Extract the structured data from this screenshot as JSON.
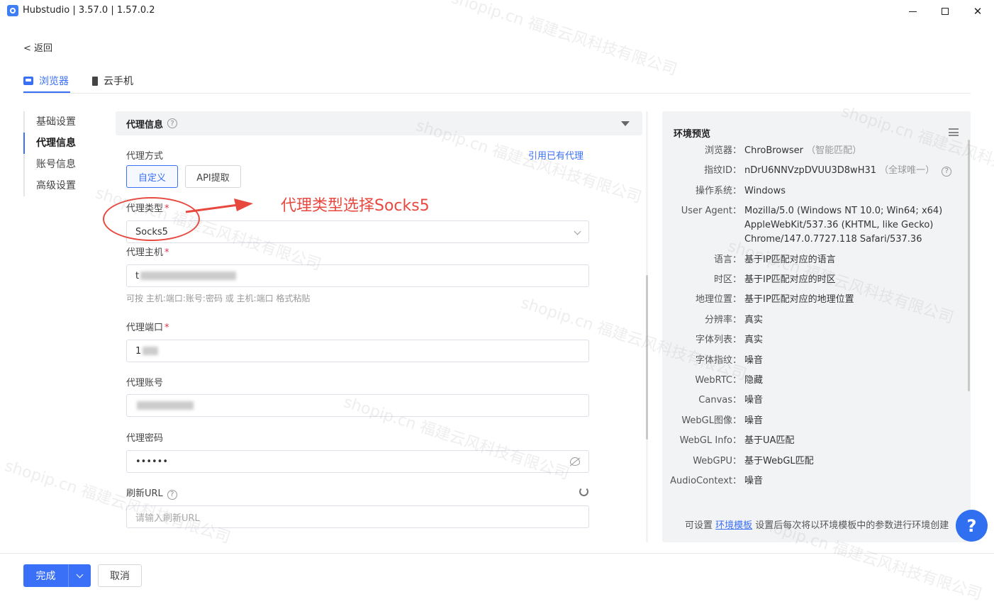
{
  "window": {
    "title": "Hubstudio | 3.57.0 | 1.57.0.2"
  },
  "nav": {
    "back_label": "< 返回"
  },
  "top_tabs": [
    {
      "label": "浏览器",
      "active": true
    },
    {
      "label": "云手机",
      "active": false
    }
  ],
  "side_nav": [
    {
      "label": "基础设置"
    },
    {
      "label": "代理信息"
    },
    {
      "label": "账号信息"
    },
    {
      "label": "高级设置"
    }
  ],
  "section": {
    "title": "代理信息"
  },
  "form": {
    "proxy_mode_label": "代理方式",
    "use_existing_link": "引用已有代理",
    "mode_custom": "自定义",
    "mode_api": "API提取",
    "proxy_type_label": "代理类型",
    "proxy_type_value": "Socks5",
    "proxy_host_label": "代理主机",
    "proxy_host_value": "t",
    "proxy_host_hint": "可按 主机:端口:账号:密码 或 主机:端口 格式粘贴",
    "proxy_port_label": "代理端口",
    "proxy_port_value": "1",
    "proxy_account_label": "代理账号",
    "proxy_password_label": "代理密码",
    "proxy_password_value": "••••••",
    "refresh_url_label": "刷新URL",
    "refresh_url_placeholder": "请输入刷新URL",
    "required_mark": "*"
  },
  "annotation": {
    "text": "代理类型选择Socks5"
  },
  "preview": {
    "title": "环境预览",
    "rows": [
      {
        "key": "浏览器：",
        "value": "ChroBrowser",
        "extra": "（智能匹配）"
      },
      {
        "key": "指纹ID：",
        "value": "nDrU6NNVzpDVUU3D8wH31",
        "extra": "（全球唯一）"
      },
      {
        "key": "操作系统：",
        "value": "Windows"
      },
      {
        "key": "User Agent：",
        "value": "Mozilla/5.0 (Windows NT 10.0; Win64; x64)\nAppleWebKit/537.36 (KHTML, like Gecko)\nChrome/147.0.7727.118 Safari/537.36"
      },
      {
        "key": "语言：",
        "value": "基于IP匹配对应的语言"
      },
      {
        "key": "时区：",
        "value": "基于IP匹配对应的时区"
      },
      {
        "key": "地理位置：",
        "value": "基于IP匹配对应的地理位置"
      },
      {
        "key": "分辨率：",
        "value": "真实"
      },
      {
        "key": "字体列表：",
        "value": "真实"
      },
      {
        "key": "字体指纹：",
        "value": "噪音"
      },
      {
        "key": "WebRTC：",
        "value": "隐藏"
      },
      {
        "key": "Canvas：",
        "value": "噪音"
      },
      {
        "key": "WebGL图像：",
        "value": "噪音"
      },
      {
        "key": "WebGL Info：",
        "value": "基于UA匹配"
      },
      {
        "key": "WebGPU：",
        "value": "基于WebGL匹配"
      },
      {
        "key": "AudioContext：",
        "value": "噪音"
      }
    ],
    "footer_prefix": "可设置 ",
    "footer_link": "环境模板",
    "footer_suffix": " 设置后每次将以环境模板中的参数进行环境创建"
  },
  "help_fab": "?",
  "footer": {
    "done_label": "完成",
    "cancel_label": "取消"
  },
  "watermark": "shopip.cn 福建云风科技有限公司",
  "colors": {
    "accent": "#3a6ff7",
    "annotation": "#e8493f"
  }
}
